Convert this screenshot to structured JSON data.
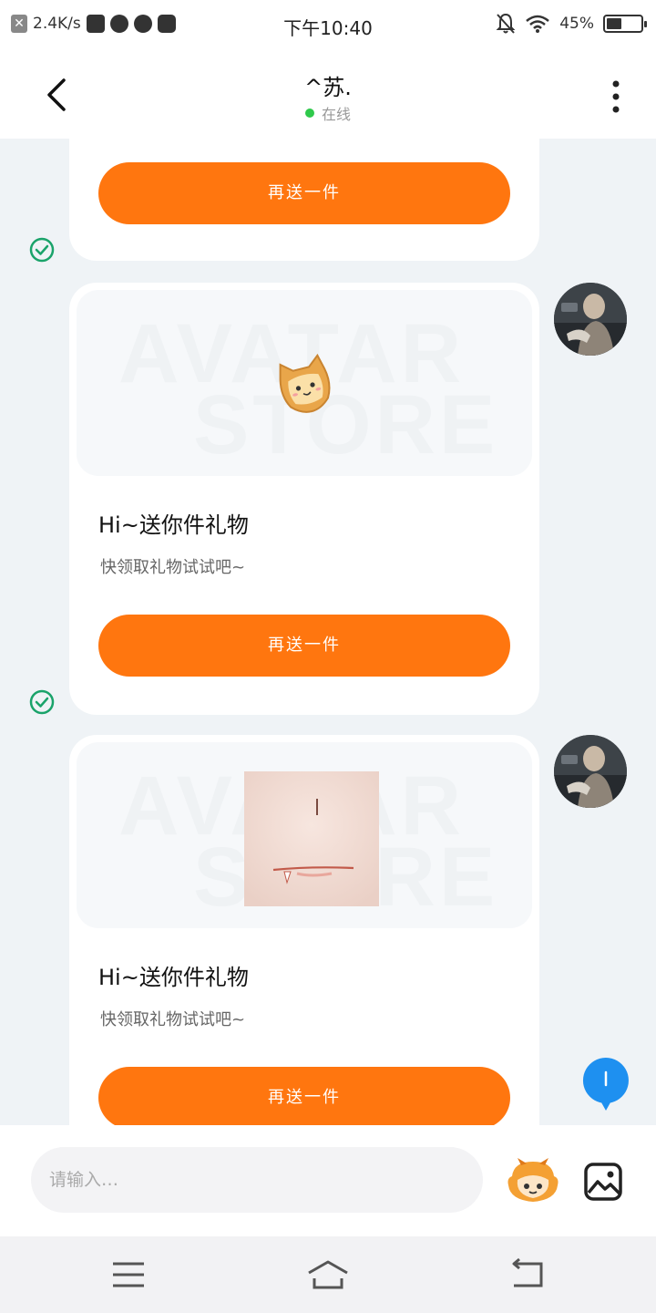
{
  "status_bar": {
    "net_speed": "2.4K/s",
    "time": "下午10:40",
    "battery": "45%",
    "battery_level": 0.45
  },
  "header": {
    "title": "^苏.",
    "status": "在线"
  },
  "messages": [
    {
      "button_label": "再送一件"
    },
    {
      "title": "Hi~送你件礼物",
      "subtitle": "快领取礼物试试吧~",
      "button_label": "再送一件",
      "watermark_top": "AVATAR",
      "watermark_bottom": "STORE"
    },
    {
      "title": "Hi~送你件礼物",
      "subtitle": "快领取礼物试试吧~",
      "button_label": "再送一件",
      "watermark_top": "AVATAR",
      "watermark_bottom": "STORE"
    }
  ],
  "composer": {
    "placeholder": "请输入…"
  },
  "colors": {
    "accent": "#ff760f",
    "online": "#2fc94b",
    "check": "#1aa36a",
    "fab": "#1e90f0"
  }
}
